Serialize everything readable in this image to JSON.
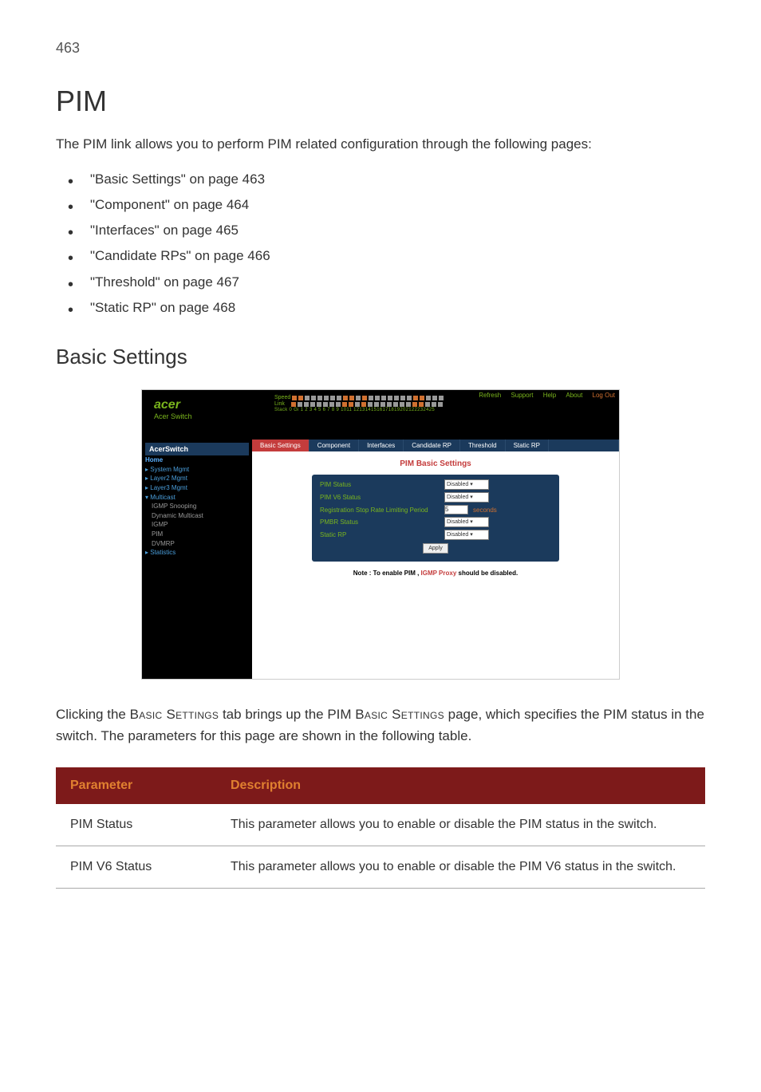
{
  "page_number": "463",
  "h1": "PIM",
  "intro": "The PIM link allows you to perform PIM related configuration through the following pages:",
  "links": [
    "\"Basic Settings\" on page 463",
    "\"Component\" on page 464",
    "\"Interfaces\" on page 465",
    "\"Candidate RPs\" on page 466",
    "\"Threshold\" on page 467",
    "\"Static RP\" on page 468"
  ],
  "h2": "Basic Settings",
  "screenshot": {
    "logo": "acer",
    "logo_sub": "Acer Switch",
    "topbar_links": {
      "refresh": "Refresh",
      "support": "Support",
      "help": "Help",
      "about": "About",
      "logout": "Log Out"
    },
    "port_labels": {
      "speed": "Speed",
      "link": "Link",
      "stack_row": "Stack 0 Gi 1 2 3 4 5 6 7 8 9 1011 1213141516171819202122232425"
    },
    "switch_label": "AcerSwitch",
    "sidebar": [
      {
        "label": "Home",
        "cls": "home"
      },
      {
        "label": "▸ System Mgmt",
        "cls": "indent0"
      },
      {
        "label": "▸ Layer2 Mgmt",
        "cls": "indent0"
      },
      {
        "label": "▸ Layer3 Mgmt",
        "cls": "indent0"
      },
      {
        "label": "▾ Multicast",
        "cls": "indent0"
      },
      {
        "label": "IGMP Snooping",
        "cls": "indent1"
      },
      {
        "label": "Dynamic Multicast",
        "cls": "indent1"
      },
      {
        "label": "IGMP",
        "cls": "indent1"
      },
      {
        "label": "PIM",
        "cls": "indent1"
      },
      {
        "label": "DVMRP",
        "cls": "indent1"
      },
      {
        "label": "▸ Statistics",
        "cls": "indent0"
      }
    ],
    "tabs": [
      {
        "label": "Basic Settings",
        "active": true
      },
      {
        "label": "Component",
        "active": false
      },
      {
        "label": "Interfaces",
        "active": false
      },
      {
        "label": "Candidate RP",
        "active": false
      },
      {
        "label": "Threshold",
        "active": false
      },
      {
        "label": "Static RP",
        "active": false
      }
    ],
    "content_title": "PIM Basic Settings",
    "form": {
      "rows": [
        {
          "label": "PIM Status",
          "value": "Disabled",
          "type": "select"
        },
        {
          "label": "PIM V6 Status",
          "value": "Disabled",
          "type": "select"
        },
        {
          "label": "Registration Stop Rate Limiting Period",
          "value": "5",
          "type": "input",
          "suffix": "seconds"
        },
        {
          "label": "PMBR Status",
          "value": "Disabled",
          "type": "select"
        },
        {
          "label": "Static RP",
          "value": "Disabled",
          "type": "select"
        }
      ],
      "apply": "Apply"
    },
    "note_prefix": "Note : To enable PIM , ",
    "note_link": "IGMP Proxy",
    "note_suffix": " should be disabled."
  },
  "body_clicking_1": "Clicking the ",
  "body_basic_settings": "Basic Settings",
  "body_clicking_2": " tab brings up the PIM ",
  "body_basic_settings_2": "Basic Settings",
  "body_clicking_3": " page, which specifies the PIM status in the switch. The parameters for this page are shown in the following table.",
  "table": {
    "headers": {
      "param": "Parameter",
      "desc": "Description"
    },
    "rows": [
      {
        "param": "PIM Status",
        "desc": "This parameter allows you to enable or disable the PIM status in the switch."
      },
      {
        "param": "PIM V6 Status",
        "desc": "This parameter allows you to enable or disable the PIM V6 status in the switch."
      }
    ]
  }
}
